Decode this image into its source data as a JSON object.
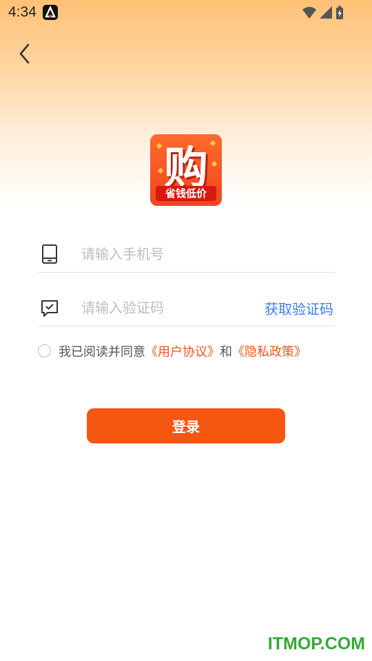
{
  "status_bar": {
    "time": "4:34"
  },
  "logo": {
    "main_char": "购",
    "banner": "省钱低价"
  },
  "phone_field": {
    "placeholder": "请输入手机号",
    "value": ""
  },
  "code_field": {
    "placeholder": "请输入验证码",
    "value": "",
    "get_code_label": "获取验证码"
  },
  "agreement": {
    "prefix": "我已阅读并同意",
    "user_agreement": "《用户协议》",
    "and": "和",
    "privacy_policy": "《隐私政策》",
    "checked": false
  },
  "login_button": {
    "label": "登录"
  },
  "watermark": "ITMOP.COM",
  "colors": {
    "accent": "#f55610",
    "link": "#f2541c",
    "code_link": "#3a7ef2"
  }
}
